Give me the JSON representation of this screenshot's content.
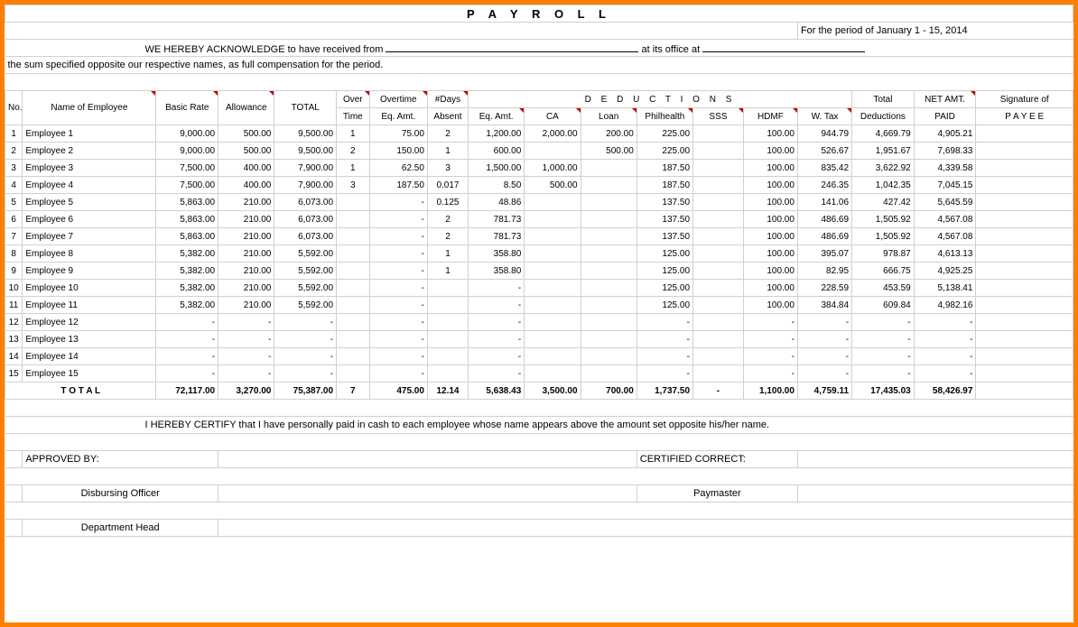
{
  "title": "P A Y R O L L",
  "period_label": "For the period of",
  "period_value": "January 1 - 15,  2014",
  "ack_line1_a": "WE HEREBY ACKNOWLEDGE to have received from",
  "ack_line1_b": "at its office at",
  "ack_line2": "the sum specified opposite our respective names, as full compensation for the period.",
  "headers": {
    "no": "No.",
    "name": "Name of Employee",
    "basic": "Basic Rate",
    "allow": "Allowance",
    "total": "TOTAL",
    "over": "Over",
    "time": "Time",
    "overtime": "Overtime",
    "eqamt": "Eq. Amt.",
    "days": "#Days",
    "absent": "Absent",
    "deductions": "D E D U C T I O N S",
    "ca": "CA",
    "loan": "Loan",
    "ph": "Philhealth",
    "sss": "SSS",
    "hdmf": "HDMF",
    "wtax": "W. Tax",
    "tded": "Total",
    "tded2": "Deductions",
    "net": "NET AMT.",
    "paid": "PAID",
    "sig": "Signature of",
    "payee": "P A Y E E"
  },
  "rows": [
    {
      "no": "1",
      "name": "Employee 1",
      "basic": "9,000.00",
      "allow": "500.00",
      "total": "9,500.00",
      "ot": "1",
      "ote": "75.00",
      "days": "2",
      "eq": "1,200.00",
      "ca": "2,000.00",
      "loan": "200.00",
      "ph": "225.00",
      "sss": "",
      "hdmf": "100.00",
      "wtax": "944.79",
      "tded": "4,669.79",
      "net": "4,905.21"
    },
    {
      "no": "2",
      "name": "Employee 2",
      "basic": "9,000.00",
      "allow": "500.00",
      "total": "9,500.00",
      "ot": "2",
      "ote": "150.00",
      "days": "1",
      "eq": "600.00",
      "ca": "",
      "loan": "500.00",
      "ph": "225.00",
      "sss": "",
      "hdmf": "100.00",
      "wtax": "526.67",
      "tded": "1,951.67",
      "net": "7,698.33"
    },
    {
      "no": "3",
      "name": "Employee 3",
      "basic": "7,500.00",
      "allow": "400.00",
      "total": "7,900.00",
      "ot": "1",
      "ote": "62.50",
      "days": "3",
      "eq": "1,500.00",
      "ca": "1,000.00",
      "loan": "",
      "ph": "187.50",
      "sss": "",
      "hdmf": "100.00",
      "wtax": "835.42",
      "tded": "3,622.92",
      "net": "4,339.58"
    },
    {
      "no": "4",
      "name": "Employee 4",
      "basic": "7,500.00",
      "allow": "400.00",
      "total": "7,900.00",
      "ot": "3",
      "ote": "187.50",
      "days": "0.017",
      "eq": "8.50",
      "ca": "500.00",
      "loan": "",
      "ph": "187.50",
      "sss": "",
      "hdmf": "100.00",
      "wtax": "246.35",
      "tded": "1,042.35",
      "net": "7,045.15"
    },
    {
      "no": "5",
      "name": "Employee 5",
      "basic": "5,863.00",
      "allow": "210.00",
      "total": "6,073.00",
      "ot": "",
      "ote": "-",
      "days": "0.125",
      "eq": "48.86",
      "ca": "",
      "loan": "",
      "ph": "137.50",
      "sss": "",
      "hdmf": "100.00",
      "wtax": "141.06",
      "tded": "427.42",
      "net": "5,645.59"
    },
    {
      "no": "6",
      "name": "Employee 6",
      "basic": "5,863.00",
      "allow": "210.00",
      "total": "6,073.00",
      "ot": "",
      "ote": "-",
      "days": "2",
      "eq": "781.73",
      "ca": "",
      "loan": "",
      "ph": "137.50",
      "sss": "",
      "hdmf": "100.00",
      "wtax": "486.69",
      "tded": "1,505.92",
      "net": "4,567.08"
    },
    {
      "no": "7",
      "name": "Employee 7",
      "basic": "5,863.00",
      "allow": "210.00",
      "total": "6,073.00",
      "ot": "",
      "ote": "-",
      "days": "2",
      "eq": "781.73",
      "ca": "",
      "loan": "",
      "ph": "137.50",
      "sss": "",
      "hdmf": "100.00",
      "wtax": "486.69",
      "tded": "1,505.92",
      "net": "4,567.08"
    },
    {
      "no": "8",
      "name": "Employee 8",
      "basic": "5,382.00",
      "allow": "210.00",
      "total": "5,592.00",
      "ot": "",
      "ote": "-",
      "days": "1",
      "eq": "358.80",
      "ca": "",
      "loan": "",
      "ph": "125.00",
      "sss": "",
      "hdmf": "100.00",
      "wtax": "395.07",
      "tded": "978.87",
      "net": "4,613.13"
    },
    {
      "no": "9",
      "name": "Employee 9",
      "basic": "5,382.00",
      "allow": "210.00",
      "total": "5,592.00",
      "ot": "",
      "ote": "-",
      "days": "1",
      "eq": "358.80",
      "ca": "",
      "loan": "",
      "ph": "125.00",
      "sss": "",
      "hdmf": "100.00",
      "wtax": "82.95",
      "tded": "666.75",
      "net": "4,925.25"
    },
    {
      "no": "10",
      "name": "Employee 10",
      "basic": "5,382.00",
      "allow": "210.00",
      "total": "5,592.00",
      "ot": "",
      "ote": "-",
      "days": "",
      "eq": "-",
      "ca": "",
      "loan": "",
      "ph": "125.00",
      "sss": "",
      "hdmf": "100.00",
      "wtax": "228.59",
      "tded": "453.59",
      "net": "5,138.41"
    },
    {
      "no": "11",
      "name": "Employee 11",
      "basic": "5,382.00",
      "allow": "210.00",
      "total": "5,592.00",
      "ot": "",
      "ote": "-",
      "days": "",
      "eq": "-",
      "ca": "",
      "loan": "",
      "ph": "125.00",
      "sss": "",
      "hdmf": "100.00",
      "wtax": "384.84",
      "tded": "609.84",
      "net": "4,982.16"
    },
    {
      "no": "12",
      "name": "Employee 12",
      "basic": "-",
      "allow": "-",
      "total": "-",
      "ot": "",
      "ote": "-",
      "days": "",
      "eq": "-",
      "ca": "",
      "loan": "",
      "ph": "-",
      "sss": "",
      "hdmf": "-",
      "wtax": "-",
      "tded": "-",
      "net": "-"
    },
    {
      "no": "13",
      "name": "Employee 13",
      "basic": "-",
      "allow": "-",
      "total": "-",
      "ot": "",
      "ote": "-",
      "days": "",
      "eq": "-",
      "ca": "",
      "loan": "",
      "ph": "-",
      "sss": "",
      "hdmf": "-",
      "wtax": "-",
      "tded": "-",
      "net": "-"
    },
    {
      "no": "14",
      "name": "Employee 14",
      "basic": "-",
      "allow": "-",
      "total": "-",
      "ot": "",
      "ote": "-",
      "days": "",
      "eq": "-",
      "ca": "",
      "loan": "",
      "ph": "-",
      "sss": "",
      "hdmf": "-",
      "wtax": "-",
      "tded": "-",
      "net": "-"
    },
    {
      "no": "15",
      "name": "Employee 15",
      "basic": "-",
      "allow": "-",
      "total": "-",
      "ot": "",
      "ote": "-",
      "days": "",
      "eq": "-",
      "ca": "",
      "loan": "",
      "ph": "-",
      "sss": "",
      "hdmf": "-",
      "wtax": "-",
      "tded": "-",
      "net": "-"
    }
  ],
  "totals": {
    "label": "T O T A L",
    "basic": "72,117.00",
    "allow": "3,270.00",
    "total": "75,387.00",
    "ot": "7",
    "ote": "475.00",
    "days": "12.14",
    "eq": "5,638.43",
    "ca": "3,500.00",
    "loan": "700.00",
    "ph": "1,737.50",
    "sss": "-",
    "hdmf": "1,100.00",
    "wtax": "4,759.11",
    "tded": "17,435.03",
    "net": "58,426.97"
  },
  "cert": "I HEREBY CERTIFY  that I have personally paid in cash to each employee whose name appears above the amount set opposite his/her name.",
  "approved": "APPROVED BY:",
  "certified": "CERTIFIED CORRECT:",
  "disbursing": "Disbursing Officer",
  "paymaster": "Paymaster",
  "depthead": "Department Head"
}
